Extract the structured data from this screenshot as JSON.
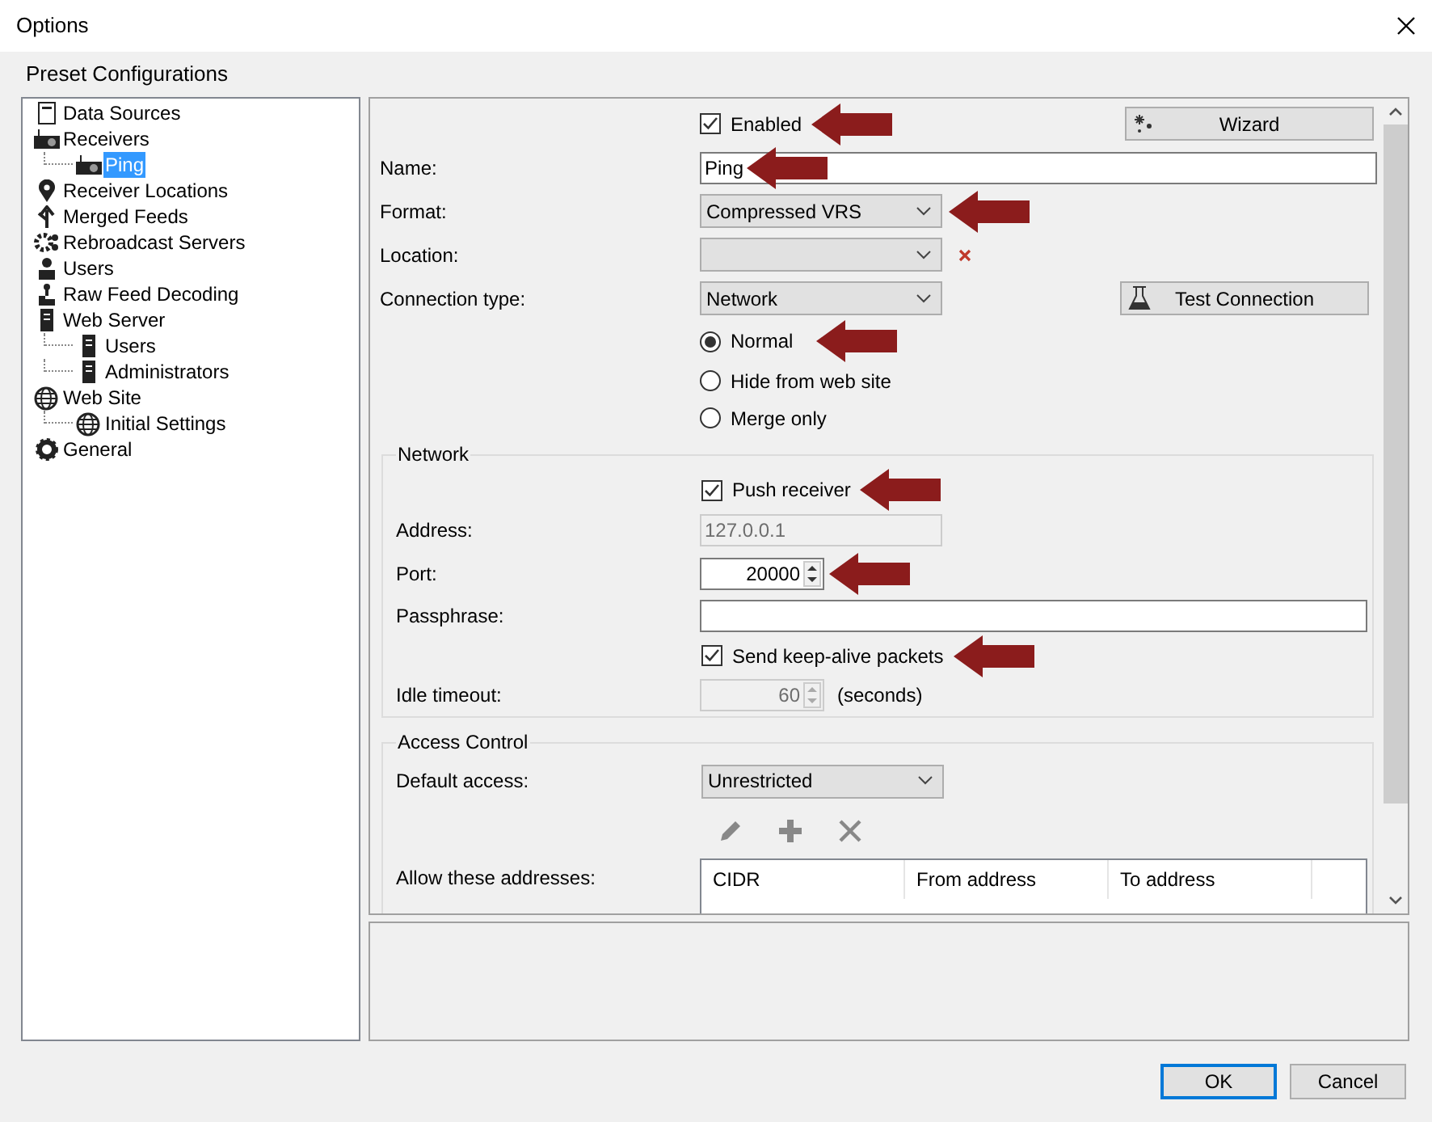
{
  "window": {
    "title": "Options"
  },
  "tree_title": "Preset Configurations",
  "tree": [
    {
      "label": "Data Sources",
      "kind": "document",
      "selected": false
    },
    {
      "label": "Receivers",
      "kind": "radio",
      "selected": false,
      "children": [
        {
          "label": "Ping",
          "kind": "radio",
          "selected": true
        }
      ]
    },
    {
      "label": "Receiver Locations",
      "kind": "pin",
      "selected": false
    },
    {
      "label": "Merged Feeds",
      "kind": "fork",
      "selected": false
    },
    {
      "label": "Rebroadcast Servers",
      "kind": "cogs",
      "selected": false
    },
    {
      "label": "Users",
      "kind": "person",
      "selected": false
    },
    {
      "label": "Raw Feed Decoding",
      "kind": "decoder",
      "selected": false
    },
    {
      "label": "Web Server",
      "kind": "server",
      "selected": false,
      "children": [
        {
          "label": "Users",
          "kind": "server",
          "selected": false
        },
        {
          "label": "Administrators",
          "kind": "server",
          "selected": false
        }
      ]
    },
    {
      "label": "Web Site",
      "kind": "globe",
      "selected": false,
      "children": [
        {
          "label": "Initial Settings",
          "kind": "globe",
          "selected": false
        }
      ]
    },
    {
      "label": "General",
      "kind": "gear",
      "selected": false
    }
  ],
  "general": {
    "enabled": {
      "label": "Enabled",
      "checked": true,
      "highlighted": true
    },
    "wizard_button": "Wizard",
    "name": {
      "label": "Name:",
      "value": "Ping",
      "highlighted": true
    },
    "format": {
      "label": "Format:",
      "value": "Compressed VRS",
      "highlighted": true
    },
    "location": {
      "label": "Location:"
    },
    "connection_type": {
      "label": "Connection type:",
      "value": "Network"
    },
    "test_button": "Test Connection",
    "visibility": [
      {
        "label": "Normal",
        "selected": true,
        "highlighted": true
      },
      {
        "label": "Hide from web site",
        "selected": false,
        "highlighted": false
      },
      {
        "label": "Merge only",
        "selected": false,
        "highlighted": false
      }
    ]
  },
  "network": {
    "title": "Network",
    "push_receiver": {
      "label": "Push receiver",
      "checked": true,
      "highlighted": true
    },
    "address": {
      "label": "Address:",
      "value": "127.0.0.1",
      "disabled": true
    },
    "port": {
      "label": "Port:",
      "value": "20000",
      "disabled": false,
      "highlighted": true
    },
    "passphrase": {
      "label": "Passphrase:"
    },
    "keep_alive": {
      "label": "Send keep-alive packets",
      "checked": true,
      "highlighted": true
    },
    "idle_timeout": {
      "label": "Idle timeout:",
      "value": "60",
      "disabled": true,
      "highlighted": false,
      "unit": "(seconds)"
    }
  },
  "access_control": {
    "title": "Access Control",
    "default_access": {
      "label": "Default access:",
      "value": "Unrestricted"
    },
    "allow_label": "Allow these addresses:",
    "columns": [
      "CIDR",
      "From address",
      "To address"
    ]
  },
  "buttons": [
    {
      "label": "OK",
      "default": true
    },
    {
      "label": "Cancel",
      "default": false
    }
  ]
}
